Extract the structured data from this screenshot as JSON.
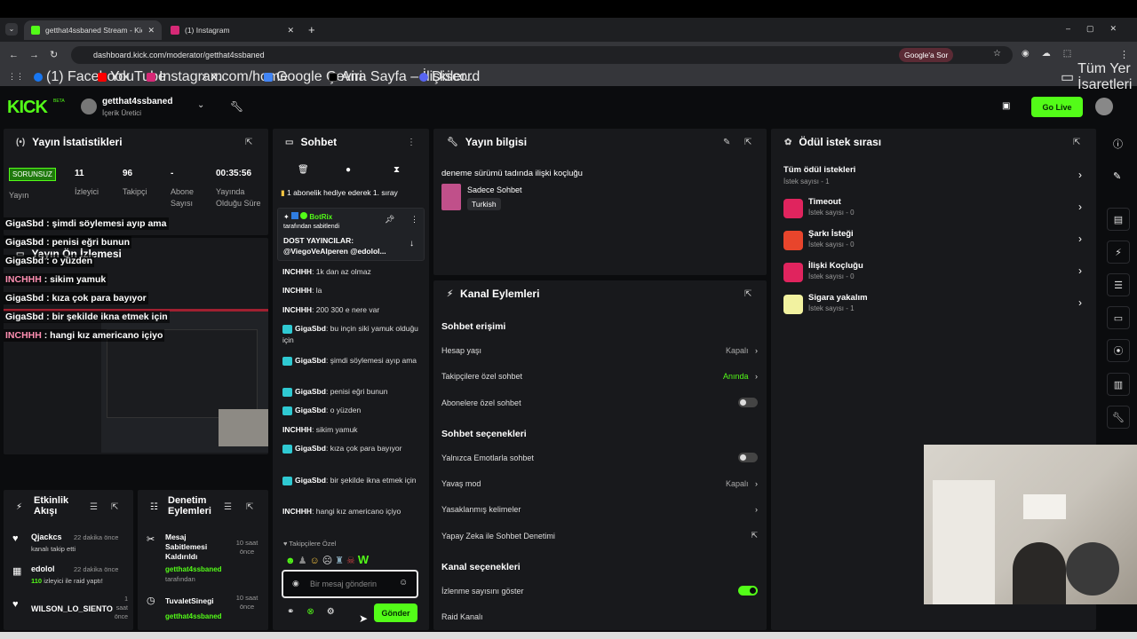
{
  "browser": {
    "tabs": [
      {
        "title": "getthat4ssbaned Stream - Kick"
      },
      {
        "title": "(1) Instagram"
      }
    ],
    "url": "dashboard.kick.com/moderator/getthat4ssbaned",
    "google_btn": "Google'a Sor",
    "bookmarks": [
      "(1) Facebook",
      "YouTube",
      "Instagram",
      "x.com/home",
      "Google Çeviri",
      "Ana Sayfa – İlişkiler...",
      "Discord"
    ],
    "all_bookmarks": "Tüm Yer İşaretleri"
  },
  "header": {
    "logo": "KICK",
    "logo_beta": "BETA",
    "channel_name": "getthat4ssbaned",
    "channel_role": "İçerik Üretici",
    "go_live": "Go Live"
  },
  "stats": {
    "title": "Yayın İstatistikleri",
    "status_badge": "SORUNSUZ",
    "status_label": "Yayın",
    "viewers_value": "11",
    "viewers_label": "İzleyici",
    "followers_value": "96",
    "followers_label": "Takipçi",
    "subs_value": "-",
    "subs_label": "Abone Sayısı",
    "uptime_value": "00:35:56",
    "uptime_label": "Yayında Olduğu Süre"
  },
  "preview": {
    "title": "Yayın Ön İzlemesi",
    "overlay_lines": [
      {
        "user": "GigaSbd",
        "text": " : şimdi söylemesi ayıp ama"
      },
      {
        "user": "GigaSbd",
        "text": " : penisi eğri bunun"
      },
      {
        "user": "GigaSbd",
        "text": " : o yüzden"
      },
      {
        "user": "INCHHH",
        "text": " : sikim yamuk"
      },
      {
        "user": "GigaSbd",
        "text": " : kıza çok para bayıyor"
      },
      {
        "user": "GigaSbd",
        "text": " : bir şekilde ikna etmek için"
      },
      {
        "user": "INCHHH",
        "text": " : hangi kız americano içiyo"
      }
    ]
  },
  "activity": {
    "title": "Etkinlik Akışı",
    "items": [
      {
        "name": "Qjackcs",
        "time": "22 dakika önce",
        "desc": "kanalı takip etti"
      },
      {
        "name": "edolol",
        "time": "22 dakika önce",
        "desc_green": "110",
        "desc": " izleyici ile raid yaptı!"
      },
      {
        "name": "WILSON_LO_SIENTO",
        "time": "1 saat önce",
        "desc": ""
      }
    ]
  },
  "moderation": {
    "title": "Denetim Eylemleri",
    "items": [
      {
        "action": "Mesaj Sabitlemesi Kaldırıldı",
        "by": "getthat4ssbaned",
        "by_suffix": "tarafından",
        "time": "10 saat önce"
      },
      {
        "action": "TuvaletSinegi",
        "by": "getthat4ssbaned",
        "by_suffix": "",
        "time": "10 saat önce"
      }
    ]
  },
  "chat": {
    "title": "Sohbet",
    "sub_banner": "1 abonelik hediye ederek 1. sıray",
    "pinned": {
      "user": "BotRix",
      "by": "tarafından sabitlendi",
      "text": "DOST YAYINCILAR: @ViegoVeAlperen @edolol..."
    },
    "messages": [
      {
        "user": "INCHHH",
        "text": "1k dan az olmaz",
        "badge": false
      },
      {
        "user": "INCHHH",
        "text": "la",
        "badge": false
      },
      {
        "user": "INCHHH",
        "text": "200 300 e nere var",
        "badge": false
      },
      {
        "user": "GigaSbd",
        "text": "bu inçin siki yamuk olduğu için",
        "badge": true
      },
      {
        "user": "GigaSbd",
        "text": "şimdi söylemesi ayıp ama",
        "badge": true
      },
      {
        "user": "GigaSbd",
        "text": "penisi eğri bunun",
        "badge": true
      },
      {
        "user": "GigaSbd",
        "text": "o yüzden",
        "badge": true
      },
      {
        "user": "INCHHH",
        "text": "sikim yamuk",
        "badge": false
      },
      {
        "user": "GigaSbd",
        "text": "kıza çok para bayıyor",
        "badge": true
      },
      {
        "user": "GigaSbd",
        "text": "bir şekilde ikna etmek için",
        "badge": true
      },
      {
        "user": "INCHHH",
        "text": "hangi kız americano içiyo",
        "badge": false
      }
    ],
    "followers_only": "Takipçilere Özel",
    "input_placeholder": "Bir mesaj gönderin",
    "send_label": "Gönder"
  },
  "stream_info": {
    "title": "Yayın bilgisi",
    "stream_title": "deneme sürümü tadında ilişki koçluğu",
    "category": "Sadece Sohbet",
    "language": "Turkish"
  },
  "channel_actions": {
    "title": "Kanal Eylemleri",
    "chat_access": "Sohbet erişimi",
    "account_age_label": "Hesap yaşı",
    "account_age_value": "Kapalı",
    "followers_chat_label": "Takipçilere özel sohbet",
    "followers_chat_value": "Anında",
    "subs_chat_label": "Abonelere özel sohbet",
    "chat_options": "Sohbet seçenekleri",
    "emote_only_label": "Yalnızca Emotlarla sohbet",
    "slow_mode_label": "Yavaş mod",
    "slow_mode_value": "Kapalı",
    "banned_words_label": "Yasaklanmış kelimeler",
    "ai_mod_label": "Yapay Zeka ile Sohbet Denetimi",
    "channel_options": "Kanal seçenekleri",
    "show_views_label": "İzlenme sayısını göster",
    "raid_label": "Raid Kanalı"
  },
  "rewards": {
    "title": "Ödül istek sırası",
    "all_label": "Tüm ödül istekleri",
    "all_count": "İstek sayısı - 1",
    "items": [
      {
        "name": "Timeout",
        "count": "İstek sayısı - 0",
        "color": "#e0245e"
      },
      {
        "name": "Şarkı İsteği",
        "count": "İstek sayısı - 0",
        "color": "#e8452c"
      },
      {
        "name": "İlişki Koçluğu",
        "count": "İstek sayısı - 0",
        "color": "#e0245e"
      },
      {
        "name": "Sigara yakalım",
        "count": "İstek sayısı - 1",
        "color": "#f2f2a0"
      }
    ]
  },
  "colors": {
    "accent": "#53fc18",
    "panel": "#18191c",
    "background": "#0b0c0e"
  }
}
